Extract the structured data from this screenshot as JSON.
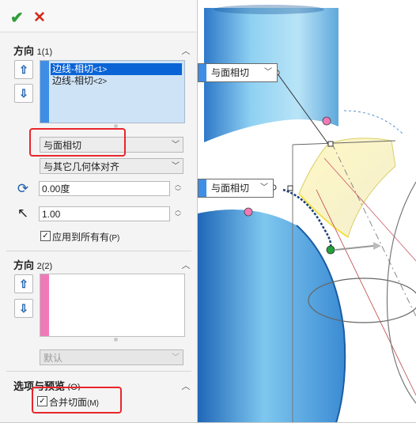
{
  "toolbar": {
    "ok_glyph": "✔",
    "cancel_glyph": "✕"
  },
  "direction1": {
    "title": "方向",
    "count": "1(1)",
    "items": [
      {
        "label": "边线-相切",
        "num": "<1>"
      },
      {
        "label": "边线-相切",
        "num": "<2>"
      }
    ],
    "tangency_select": "与面相切",
    "align_select": "与其它几何体对齐",
    "angle_value": "0.00度",
    "ratio_value": "1.00",
    "apply_all_label": "应用到所有有",
    "apply_all_accel": "(P)",
    "apply_all_checked": true,
    "list_bar_color": "#3e8ee6"
  },
  "direction2": {
    "title": "方向",
    "count": "2(2)",
    "default_select": "默认",
    "list_bar_color": "#f07ab8"
  },
  "options": {
    "title": "选项与预览",
    "count": "(O)",
    "merge_label": "合并切面",
    "merge_accel": "(M)",
    "merge_checked": true
  },
  "viewport": {
    "callout_top": "与面相切",
    "callout_mid": "与面相切"
  },
  "colors": {
    "accent_blue": "#3e8ee6",
    "highlight_red": "#e8262b",
    "pink_handle": "#f07ab8",
    "green_handle": "#1fa33a"
  }
}
